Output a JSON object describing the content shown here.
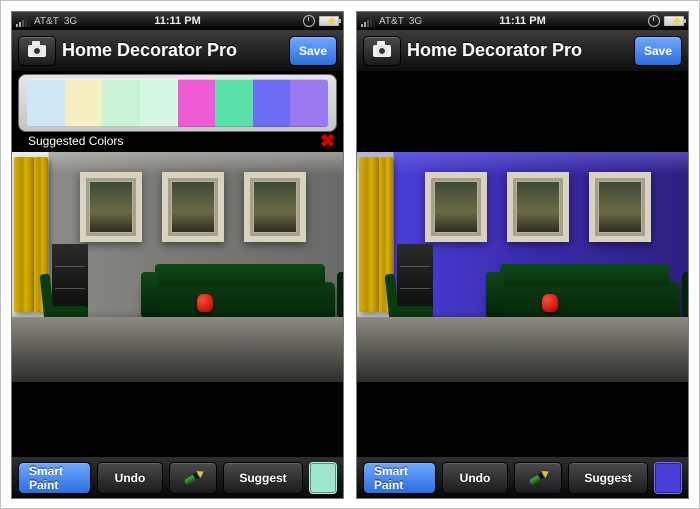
{
  "status": {
    "carrier": "AT&T",
    "network": "3G",
    "time": "11:11 PM"
  },
  "nav": {
    "title": "Home Decorator Pro",
    "save": "Save"
  },
  "palette": {
    "caption": "Suggested Colors",
    "colors": [
      "#cfe7f5",
      "#f6efc0",
      "#c9f2d6",
      "#d6f7e4",
      "#ef5bd6",
      "#58e0a8",
      "#6a6cf4",
      "#9a7af2"
    ]
  },
  "toolbar": {
    "smart_paint": "Smart Paint",
    "undo": "Undo",
    "suggest": "Suggest"
  },
  "screens": {
    "left": {
      "wall_color": "#8b8b88",
      "selected_color": "#9fe8d0"
    },
    "right": {
      "wall_color": "#3a2fbf",
      "selected_color": "#4a3fd8"
    }
  }
}
